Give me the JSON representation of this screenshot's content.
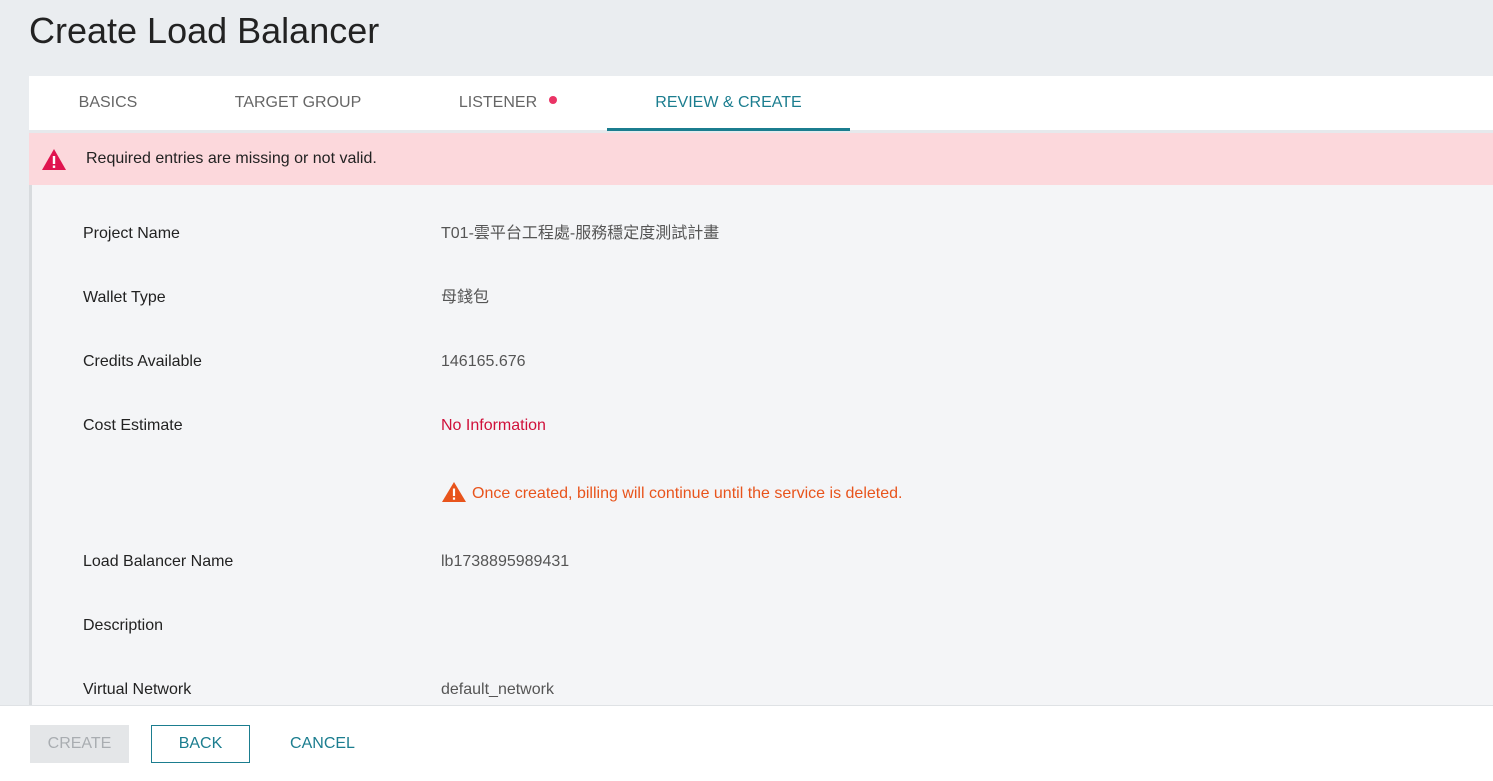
{
  "page": {
    "title": "Create Load Balancer"
  },
  "tabs": [
    {
      "label": "BASICS",
      "active": false,
      "error": false
    },
    {
      "label": "TARGET GROUP",
      "active": false,
      "error": false
    },
    {
      "label": "LISTENER",
      "active": false,
      "error": true
    },
    {
      "label": "REVIEW & CREATE",
      "active": true,
      "error": false
    }
  ],
  "alert": {
    "message": "Required entries are missing or not valid.",
    "icon": "warning-triangle-icon"
  },
  "review": {
    "project_name": {
      "label": "Project Name",
      "value": "T01-雲平台工程處-服務穩定度測試計畫"
    },
    "wallet_type": {
      "label": "Wallet Type",
      "value": "母錢包"
    },
    "credits_available": {
      "label": "Credits Available",
      "value": "146165.676"
    },
    "cost_estimate": {
      "label": "Cost Estimate",
      "value": "No Information"
    },
    "billing_warning": "Once created, billing will continue until the service is deleted.",
    "lb_name": {
      "label": "Load Balancer Name",
      "value": "lb1738895989431"
    },
    "description": {
      "label": "Description",
      "value": ""
    },
    "virtual_network": {
      "label": "Virtual Network",
      "value": "default_network"
    }
  },
  "footer": {
    "create_label": "CREATE",
    "back_label": "BACK",
    "cancel_label": "CANCEL"
  },
  "colors": {
    "accent": "#1b7d8f",
    "error": "#d0103a",
    "warning": "#e8541c",
    "alert_bg": "#fcd8dc"
  }
}
